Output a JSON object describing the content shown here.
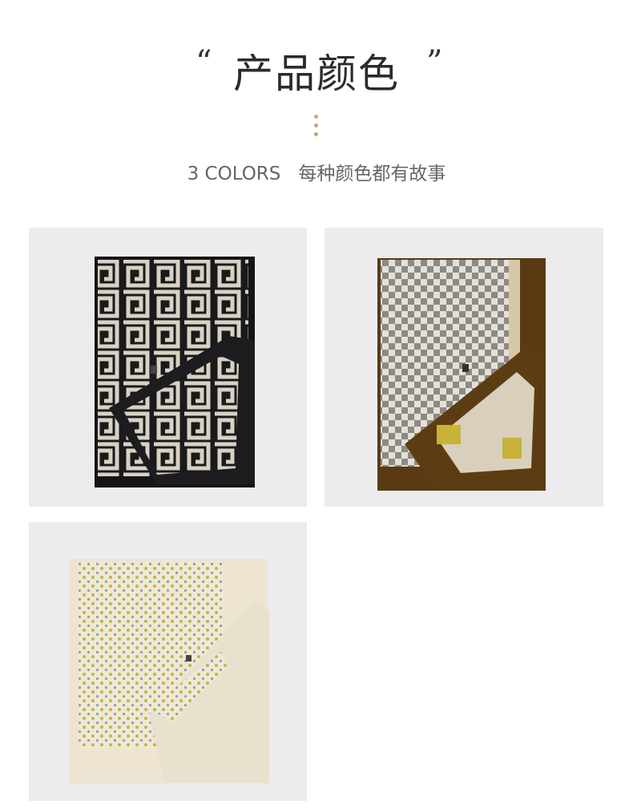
{
  "header": {
    "open_quote": "“",
    "title": "产品颜色",
    "close_quote": "”",
    "subtitle_en": "3 COLORS",
    "subtitle_cn": "每种颜色都有故事"
  },
  "colors": {
    "accent": "#c9a473",
    "background": "#ececee"
  },
  "products": [
    {
      "name": "black-greek-key-scarf"
    },
    {
      "name": "brown-checker-scarf"
    },
    {
      "name": "cream-dotted-scarf"
    }
  ]
}
